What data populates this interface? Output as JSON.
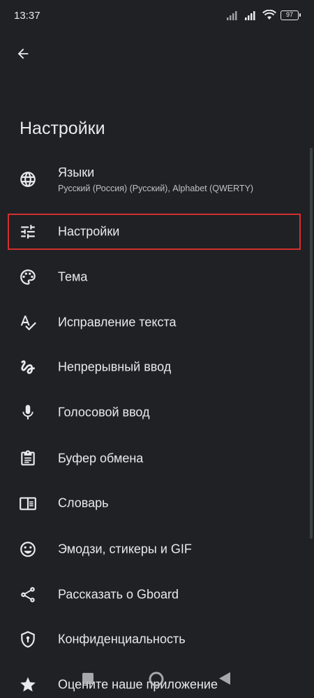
{
  "status_bar": {
    "time": "13:37",
    "battery_level": "97"
  },
  "header": {
    "title": "Настройки"
  },
  "menu": {
    "items": [
      {
        "label": "Языки",
        "sublabel": "Русский (Россия) (Русский), Alphabet (QWERTY)",
        "icon": "globe-icon"
      },
      {
        "label": "Настройки",
        "icon": "tune-icon",
        "highlighted": true
      },
      {
        "label": "Тема",
        "icon": "palette-icon"
      },
      {
        "label": "Исправление текста",
        "icon": "spellcheck-icon"
      },
      {
        "label": "Непрерывный ввод",
        "icon": "gesture-icon"
      },
      {
        "label": "Голосовой ввод",
        "icon": "microphone-icon"
      },
      {
        "label": "Буфер обмена",
        "icon": "clipboard-icon"
      },
      {
        "label": "Словарь",
        "icon": "dictionary-icon"
      },
      {
        "label": "Эмодзи, стикеры и GIF",
        "icon": "emoji-icon"
      },
      {
        "label": "Рассказать о Gboard",
        "icon": "share-icon"
      },
      {
        "label": "Конфиденциальность",
        "icon": "shield-icon"
      },
      {
        "label": "Оцените наше приложение",
        "icon": "star-icon"
      }
    ]
  },
  "colors": {
    "background": "#202124",
    "text": "#e8eaed",
    "secondary_text": "#bdc1c6",
    "highlight_border": "#d32f2f"
  }
}
